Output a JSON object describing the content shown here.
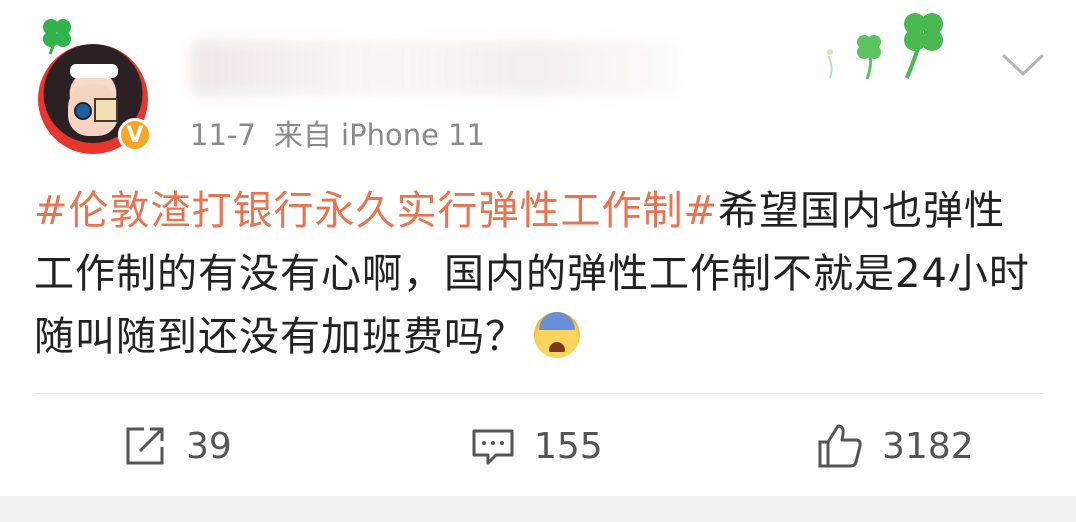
{
  "post": {
    "timestamp": "11-7",
    "source": "来自 iPhone 11",
    "text_segments": {
      "hashtag": "#伦敦渣打银行永久实行弹性工作制#",
      "body": "希望国内也弹性工作制的有没有心啊，国内的弹性工作制不就是24小时随叫随到还没有加班费吗？"
    },
    "emoji": "fearful-face-emoji",
    "verified_badge": "V"
  },
  "actions": {
    "repost_count": "39",
    "comment_count": "155",
    "like_count": "3182"
  },
  "colors": {
    "hashtag": "#eb7350",
    "verified": "#f6a623",
    "meta_text": "#8a8a8a",
    "body_text": "#222222"
  },
  "icons": [
    "clover-icon",
    "chevron-down-icon",
    "repost-icon",
    "comment-icon",
    "like-icon"
  ]
}
